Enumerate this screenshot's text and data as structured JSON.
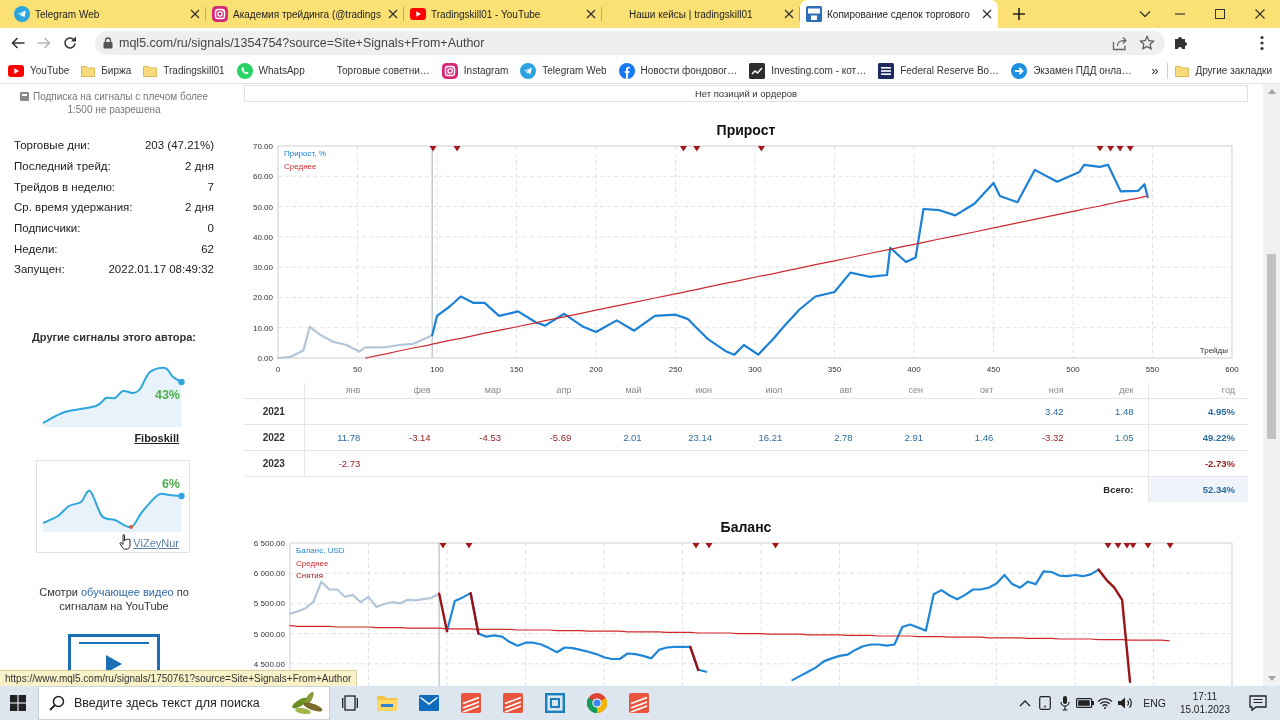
{
  "browser": {
    "tabs": [
      {
        "title": "Telegram Web",
        "kind": "plane",
        "selected": false
      },
      {
        "title": "Академия трейдинга (@tradings",
        "kind": "camera",
        "selected": false
      },
      {
        "title": "Tradingskill01 - YouTube",
        "kind": "video",
        "selected": false
      },
      {
        "title": "Наши кейсы | tradingskill01",
        "kind": "none",
        "selected": false
      },
      {
        "title": "Копирование сделок торгового",
        "kind": "tile",
        "selected": true
      }
    ],
    "navigation": {
      "back_enabled": true,
      "forward_enabled": false
    },
    "address": "mql5.com/ru/signals/1354754?source=Site+Signals+From+Author",
    "bookmarks": [
      {
        "label": "YouTube",
        "kind": "video"
      },
      {
        "label": "Биржа",
        "kind": "folder"
      },
      {
        "label": "Tradingskill01",
        "kind": "folder"
      },
      {
        "label": "WhatsApp",
        "kind": "phone"
      },
      {
        "label": "Торговые советни…",
        "kind": "blank"
      },
      {
        "label": "Instagram",
        "kind": "camera"
      },
      {
        "label": "Telegram Web",
        "kind": "plane"
      },
      {
        "label": "Новости фондовог…",
        "kind": "round"
      },
      {
        "label": "Investing.com - кот…",
        "kind": "dark"
      },
      {
        "label": "Federal Reserve Bo…",
        "kind": "navy"
      },
      {
        "label": "Экзамен ПДД онла…",
        "kind": "arrow"
      }
    ],
    "more": "»",
    "other_bookmarks": "Другие закладки"
  },
  "sidebar": {
    "notice": "Подписка на сигналы с плечом более 1:500 не разрешена",
    "stats": [
      {
        "label": "Торговые дни:",
        "value": "203 (47.21%)"
      },
      {
        "label": "Последний трейд:",
        "value": "2 дня"
      },
      {
        "label": "Трейдов в неделю:",
        "value": "7"
      },
      {
        "label": "Ср. время удержания:",
        "value": "2 дня"
      },
      {
        "label": "Подписчики:",
        "value": "0"
      },
      {
        "label": "Недели:",
        "value": "62"
      },
      {
        "label": "Запущен:",
        "value": "2022.01.17 08:49:32"
      }
    ],
    "others_title": "Другие сигналы этого автора:",
    "others": [
      {
        "gain": "43%",
        "name": "Fiboskill",
        "hovered": false
      },
      {
        "gain": "6%",
        "name": "ViZeyNur",
        "hovered": true
      }
    ],
    "video_note": {
      "before": "Смотри",
      "link": "обучающее видео",
      "after": "по сигналам на YouTube"
    }
  },
  "positions": {
    "message": "Нет позиций и ордеров"
  },
  "growth": {
    "title": "Прирост",
    "chart_data": {
      "type": "line",
      "xlabel": "Трейды",
      "grid": true,
      "x": [
        0,
        8,
        16,
        20,
        27,
        35,
        43,
        51,
        55,
        68,
        76,
        85,
        94,
        97,
        100,
        108,
        113,
        115,
        123,
        130,
        139,
        151,
        162,
        168,
        180,
        192,
        200,
        213,
        224,
        237,
        250,
        255,
        258,
        263,
        270,
        282,
        287,
        293,
        302,
        304,
        311,
        318,
        328,
        338,
        350,
        360,
        372,
        383,
        385,
        395,
        401,
        406,
        416,
        426,
        438,
        450,
        454,
        465,
        476,
        490,
        504,
        507,
        517,
        522,
        524,
        530,
        536,
        541,
        545,
        547
      ],
      "series": [
        {
          "color": "#b3c6d9",
          "values": [
            0,
            0.4,
            2.5,
            10.3,
            7.5,
            5.3,
            4.3,
            2.1,
            3.5,
            3.6,
            4.3,
            4.7,
            6.8,
            7.5,
            null,
            null,
            null,
            null,
            null,
            null,
            null,
            null,
            null,
            null,
            null,
            null,
            null,
            null,
            null,
            null,
            null,
            null,
            null,
            null,
            null,
            null,
            null,
            null,
            null,
            null,
            null,
            null,
            null,
            null,
            null,
            null,
            null,
            null,
            null,
            null,
            null,
            null,
            null,
            null,
            null,
            null,
            null,
            null,
            null,
            null,
            null,
            null,
            null,
            null,
            null,
            null,
            null,
            null,
            null,
            null
          ]
        },
        {
          "name": "Прирост, %",
          "color": "#1b80d6",
          "values": [
            null,
            null,
            null,
            null,
            null,
            null,
            null,
            null,
            null,
            null,
            null,
            null,
            null,
            7.5,
            13.9,
            17,
            19.4,
            20.3,
            18.2,
            18.2,
            13.9,
            15.4,
            11.8,
            10.7,
            14.6,
            10.3,
            8.6,
            12.4,
            9,
            13.9,
            14.3,
            13.4,
            12.8,
            10.1,
            6.4,
            2.1,
            1.1,
            4.3,
            1.1,
            2.2,
            6,
            10.3,
            16,
            20.3,
            21.8,
            28.2,
            26.8,
            27.4,
            36.4,
            31.7,
            33.2,
            49.2,
            48.8,
            47.1,
            50.9,
            57.8,
            53.5,
            51.4,
            62.1,
            58.2,
            61.4,
            63.8,
            63.1,
            63.8,
            61.6,
            55,
            55.1,
            55.2,
            57.4,
            53.1
          ]
        },
        {
          "name": "Среднее",
          "color": "#cc2a2f",
          "values": [
            null,
            null,
            null,
            null,
            null,
            null,
            null,
            null,
            0,
            1.4,
            2.3,
            3.3,
            4.2,
            4.6,
            4.9,
            5.8,
            6.3,
            6.5,
            7.4,
            8.2,
            9.1,
            10.4,
            11.6,
            12.3,
            13.6,
            14.9,
            15.8,
            17.2,
            18.4,
            19.8,
            21.2,
            21.7,
            22.1,
            22.6,
            23.4,
            24.7,
            25.2,
            25.9,
            26.9,
            27.1,
            27.8,
            28.6,
            29.7,
            30.8,
            32.1,
            33.2,
            34.5,
            35.7,
            35.9,
            37,
            37.6,
            38.2,
            39.3,
            40.3,
            41.6,
            43,
            43.4,
            44.6,
            45.8,
            47.3,
            48.8,
            49.2,
            50.2,
            50.8,
            51,
            51.7,
            52.3,
            52.8,
            53.3,
            53.5
          ]
        }
      ],
      "xlim": [
        0,
        600
      ],
      "ylim": [
        0,
        70
      ],
      "xticks": [
        0,
        50,
        100,
        150,
        200,
        250,
        300,
        350,
        400,
        450,
        500,
        550,
        600
      ],
      "yticks": [
        {
          "value": 0,
          "label": "0.00"
        },
        {
          "value": 10,
          "label": "10.00"
        },
        {
          "value": 20,
          "label": "20.00"
        },
        {
          "value": 30,
          "label": "30.00"
        },
        {
          "value": 40,
          "label": "40.00"
        },
        {
          "value": 50,
          "label": "50.00"
        },
        {
          "value": 60,
          "label": "60.00"
        },
        {
          "value": 70,
          "label": "70.00"
        }
      ],
      "ref_lines": [
        {
          "axis": "x",
          "value": 97
        }
      ]
    }
  },
  "monthly": {
    "columns": [
      "янв",
      "фев",
      "мар",
      "апр",
      "май",
      "июн",
      "июл",
      "авг",
      "сен",
      "окт",
      "ноя",
      "дек",
      "год"
    ],
    "rows": [
      {
        "year": "2021",
        "cells": [
          null,
          null,
          null,
          null,
          null,
          null,
          null,
          null,
          null,
          null,
          {
            "value": "3.42",
            "negative": false
          },
          {
            "value": "1.48",
            "negative": false
          }
        ],
        "total": {
          "value": "4.95%",
          "negative": false
        }
      },
      {
        "year": "2022",
        "cells": [
          {
            "value": "11.78",
            "negative": false
          },
          {
            "value": "-3.14",
            "negative": true
          },
          {
            "value": "-4.53",
            "negative": true
          },
          {
            "value": "-5.69",
            "negative": true
          },
          {
            "value": "2.01",
            "negative": false
          },
          {
            "value": "23.14",
            "negative": false
          },
          {
            "value": "16.21",
            "negative": false
          },
          {
            "value": "2.78",
            "negative": false
          },
          {
            "value": "2.91",
            "negative": false
          },
          {
            "value": "1.46",
            "negative": false
          },
          {
            "value": "-3.32",
            "negative": true
          },
          {
            "value": "1.05",
            "negative": false
          }
        ],
        "total": {
          "value": "49.22%",
          "negative": false
        }
      },
      {
        "year": "2023",
        "cells": [
          {
            "value": "-2.73",
            "negative": true
          },
          null,
          null,
          null,
          null,
          null,
          null,
          null,
          null,
          null,
          null,
          null
        ],
        "total": {
          "value": "-2.73%",
          "negative": true
        }
      }
    ],
    "total_label": "Всего:",
    "total": {
      "value": "52.34%",
      "negative": false
    }
  },
  "balance": {
    "title": "Баланс",
    "chart_data": {
      "type": "line",
      "grid": true,
      "series": [
        {
          "color": "#b3c6d9",
          "values": [
            5330,
            5370,
            5420,
            5530,
            5860,
            5730,
            5730,
            5610,
            5640,
            5520,
            5610,
            5440,
            5490,
            5520,
            5500,
            5560,
            5550,
            5570,
            5590,
            5660,
            null,
            null,
            null,
            null,
            null,
            null,
            null,
            null,
            null,
            null,
            null,
            null,
            null,
            null,
            null,
            null,
            null,
            null,
            null,
            null,
            null,
            null,
            null,
            null,
            null,
            null,
            null,
            null,
            null,
            null,
            null,
            null,
            null,
            null,
            null,
            null,
            null,
            null,
            null,
            null,
            null,
            null,
            null,
            null,
            null,
            null,
            null,
            null,
            null,
            null,
            null,
            null,
            null,
            null,
            null,
            null,
            null,
            null,
            null,
            null,
            null,
            null,
            null,
            null,
            null,
            null,
            null,
            null,
            null,
            null,
            null,
            null,
            null,
            null,
            null,
            null,
            null,
            null,
            null,
            null,
            null,
            null,
            null,
            null,
            null,
            null,
            null,
            null,
            null,
            null,
            null,
            null,
            null,
            null,
            null,
            null,
            null,
            null,
            null,
            null,
            null
          ]
        },
        {
          "name": "Баланс, USD",
          "color": "#1f86d8",
          "values": [
            null,
            null,
            null,
            null,
            null,
            null,
            null,
            null,
            null,
            null,
            null,
            null,
            null,
            null,
            null,
            null,
            null,
            null,
            null,
            null,
            5040,
            5540,
            5600,
            5670,
            5000,
            4950,
            4970,
            4950,
            4860,
            4800,
            4850,
            4850,
            4820,
            4760,
            4690,
            4770,
            4760,
            4730,
            4700,
            4660,
            4610,
            4580,
            4580,
            4670,
            4660,
            4630,
            4590,
            4730,
            4770,
            4780,
            4780,
            4780,
            4400,
            4370,
            null,
            null,
            null,
            null,
            null,
            null,
            null,
            null,
            null,
            null,
            4230,
            4300,
            4370,
            4440,
            4540,
            4590,
            4630,
            4650,
            4730,
            4790,
            4820,
            4820,
            4800,
            4820,
            5110,
            5150,
            5100,
            5050,
            5650,
            5720,
            5630,
            5570,
            5640,
            5730,
            5730,
            5760,
            5830,
            5970,
            5820,
            5760,
            5860,
            5820,
            6030,
            6020,
            5960,
            5950,
            5970,
            5950,
            5980,
            6060,
            null,
            null,
            null,
            null,
            null,
            null,
            null,
            null,
            null,
            null,
            null,
            null,
            null,
            null,
            null,
            null,
            null
          ]
        },
        {
          "name": "Среднее",
          "color": "#d02a2a",
          "values": [
            5130,
            5120,
            5120,
            5120,
            5120,
            5120,
            5110,
            5110,
            5110,
            5110,
            5110,
            5100,
            5100,
            5100,
            5100,
            5090,
            5090,
            5090,
            5090,
            5090,
            5080,
            5080,
            5080,
            5080,
            5070,
            5070,
            5070,
            5070,
            5070,
            5060,
            5060,
            5060,
            5060,
            5060,
            5050,
            5050,
            5050,
            5050,
            5040,
            5040,
            5040,
            5040,
            5040,
            5030,
            5030,
            5030,
            5030,
            5030,
            5020,
            5020,
            5020,
            5020,
            5010,
            5010,
            5010,
            5010,
            5010,
            5000,
            5000,
            5000,
            5000,
            4990,
            4990,
            4990,
            4990,
            4990,
            4980,
            4980,
            4980,
            4980,
            4980,
            4970,
            4970,
            4970,
            4970,
            4960,
            4960,
            4960,
            4960,
            4960,
            4950,
            4950,
            4950,
            4950,
            4940,
            4940,
            4940,
            4940,
            4940,
            4930,
            4930,
            4930,
            4930,
            4930,
            4920,
            4920,
            4920,
            4920,
            4910,
            4910,
            4910,
            4910,
            4910,
            4900,
            4900,
            4900,
            4900,
            4890,
            4890,
            4890,
            4890,
            4890,
            4880,
            null,
            null,
            null,
            null,
            null,
            null,
            null,
            null
          ]
        },
        {
          "name": "Снятия",
          "color": "#9a1515",
          "values": [
            null,
            null,
            null,
            null,
            null,
            null,
            null,
            null,
            null,
            null,
            null,
            null,
            null,
            null,
            null,
            null,
            null,
            null,
            null,
            5660,
            5040,
            null,
            null,
            5670,
            5000,
            null,
            null,
            null,
            null,
            null,
            null,
            null,
            null,
            null,
            null,
            null,
            null,
            null,
            null,
            null,
            null,
            null,
            null,
            null,
            null,
            null,
            null,
            null,
            null,
            null,
            null,
            4780,
            4400,
            null,
            null,
            null,
            null,
            null,
            null,
            null,
            null,
            null,
            null,
            null,
            null,
            null,
            null,
            null,
            null,
            null,
            null,
            null,
            null,
            null,
            null,
            null,
            null,
            null,
            null,
            null,
            null,
            null,
            null,
            null,
            null,
            null,
            null,
            null,
            null,
            null,
            null,
            null,
            null,
            null,
            null,
            null,
            null,
            null,
            null,
            null,
            null,
            null,
            null,
            6060,
            5890,
            5760,
            5560,
            4200,
            null,
            null,
            null,
            null,
            null,
            null,
            null,
            null,
            null,
            null,
            null,
            null,
            null
          ]
        }
      ],
      "ylim": [
        4000,
        6500
      ],
      "yticks": [
        {
          "value": 4500,
          "label": "4 500.00"
        },
        {
          "value": 5000,
          "label": "5 000.00"
        },
        {
          "value": 5500,
          "label": "5 500.00"
        },
        {
          "value": 6000,
          "label": "6 000.00"
        },
        {
          "value": 6500,
          "label": "6 500.00"
        }
      ]
    }
  },
  "status_link": "https://www.mql5.com/ru/signals/1750761?source=Site+Signals+From+Author",
  "taskbar": {
    "search": {
      "placeholder": "Введите здесь текст для поиска"
    },
    "language": "ENG",
    "time": "17:11",
    "date": "15.01.2023"
  }
}
